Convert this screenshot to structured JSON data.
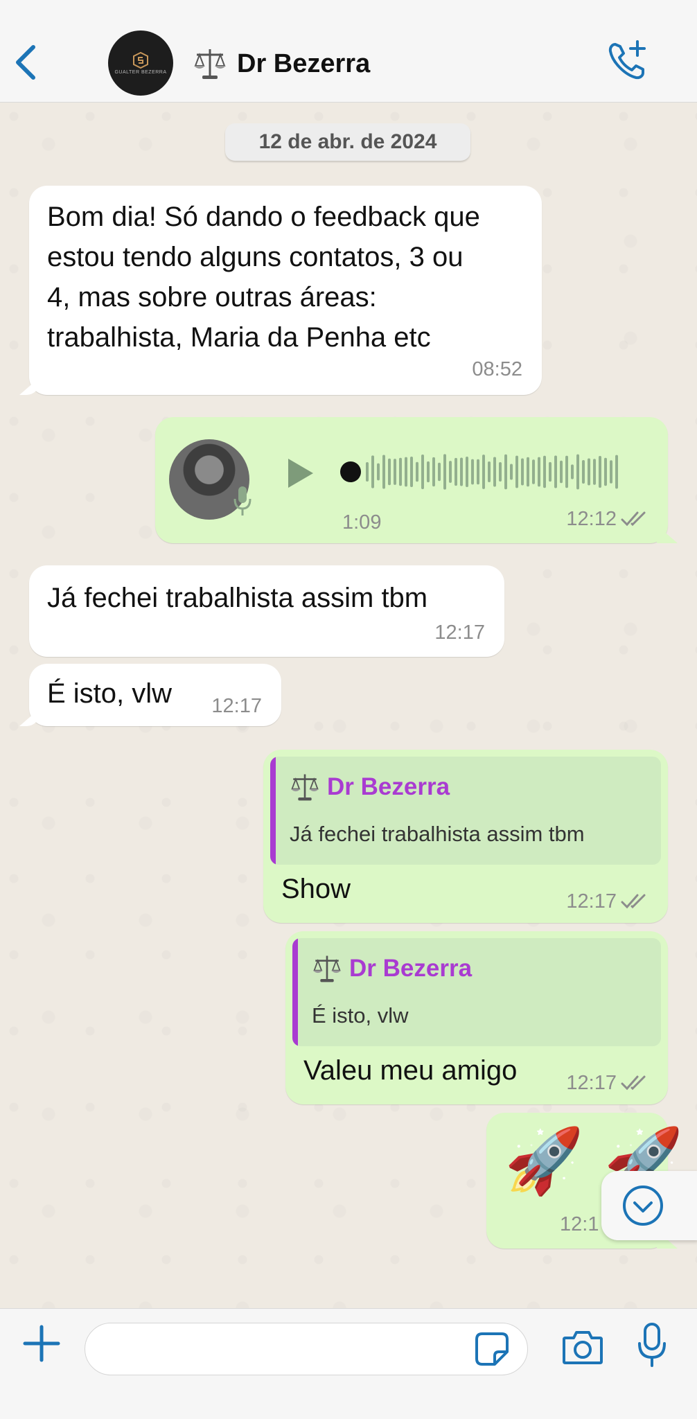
{
  "header": {
    "contact_name": "Dr Bezerra",
    "avatar_text": "GUALTER BEZERRA",
    "accent_color": "#1C74B6"
  },
  "date_divider": "12 de abr. de 2024",
  "messages": [
    {
      "direction": "in",
      "lines": [
        "Bom dia! Só dando o feedback que",
        "estou tendo alguns contatos, 3 ou",
        "4, mas sobre outras áreas:",
        "trabalhista, Maria da Penha etc"
      ],
      "time": "08:52"
    },
    {
      "direction": "out",
      "type": "audio",
      "duration": "1:09",
      "time": "12:12",
      "status": "read"
    },
    {
      "direction": "in",
      "text": "Já fechei trabalhista assim tbm",
      "time": "12:17"
    },
    {
      "direction": "in",
      "text": "É isto, vlw",
      "time": "12:17"
    },
    {
      "direction": "out",
      "quote_author": "Dr Bezerra",
      "quote_text": "Já fechei trabalhista assim tbm",
      "text": "Show",
      "time": "12:17",
      "status": "read"
    },
    {
      "direction": "out",
      "quote_author": "Dr Bezerra",
      "quote_text": "É isto, vlw",
      "text": "Valeu meu amigo",
      "time": "12:17",
      "status": "read"
    },
    {
      "direction": "out",
      "type": "emoji",
      "text": "🚀 🚀",
      "time": "12:1",
      "status": "read"
    }
  ],
  "composer": {
    "value": "",
    "placeholder": ""
  },
  "icons": {
    "back": "chevron-left-icon",
    "call": "phone-plus-icon",
    "plus": "plus-icon",
    "sticker": "sticker-icon",
    "camera": "camera-icon",
    "mic": "microphone-icon",
    "scroll": "chevron-down-circle-icon"
  },
  "colors": {
    "incoming": "#FFFFFF",
    "outgoing": "#DCF8C6",
    "quote_author": "#A93BD1",
    "tick": "#8C8C8C"
  }
}
